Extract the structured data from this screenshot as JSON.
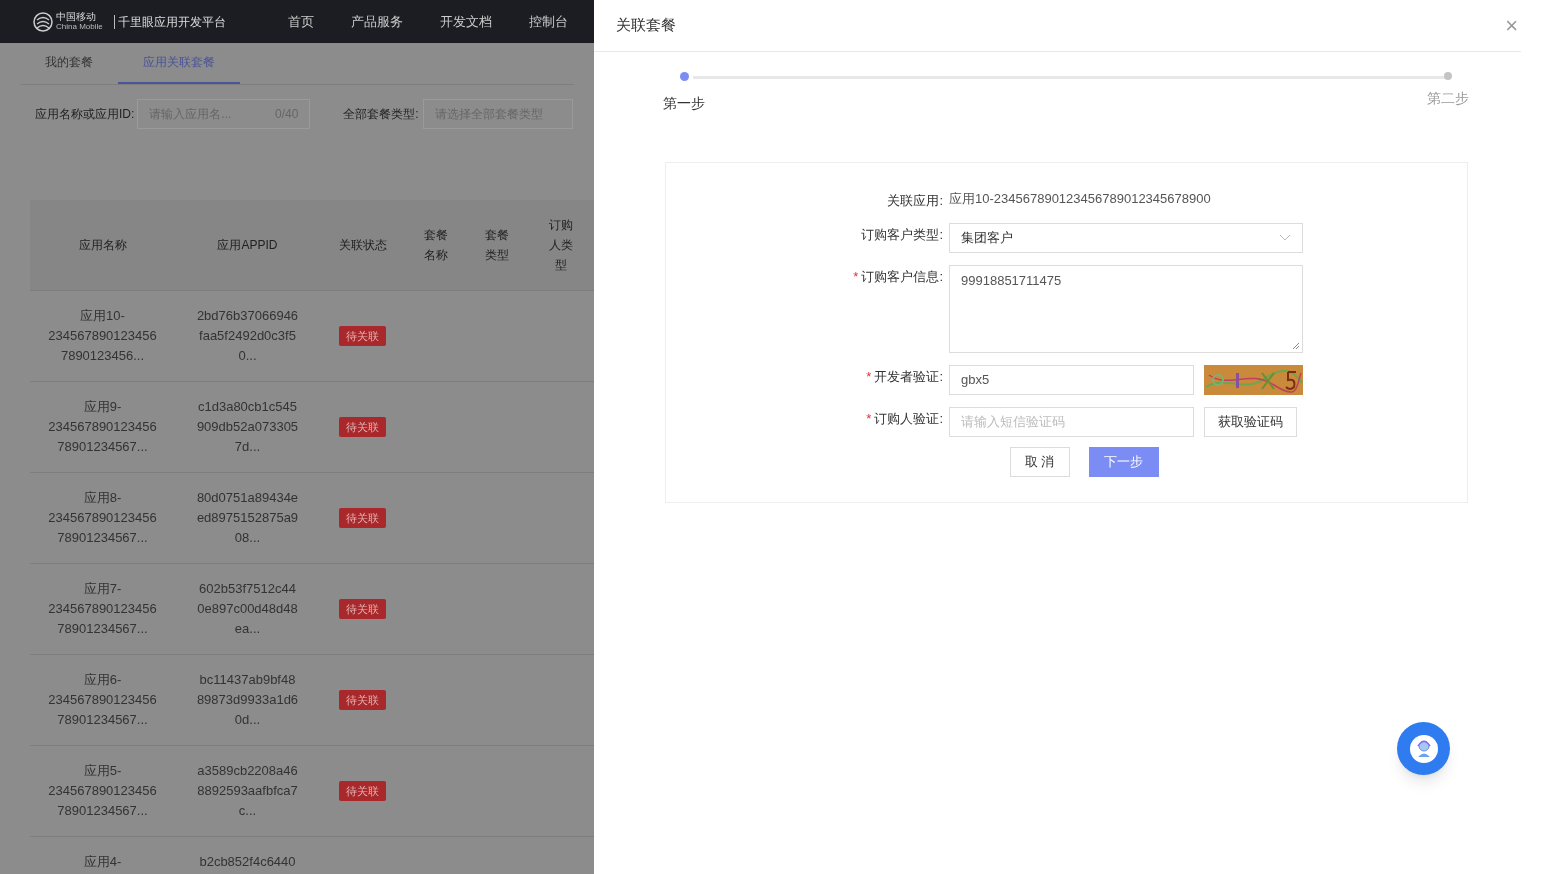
{
  "header": {
    "logo_cn": "中国移动",
    "logo_en": "China Mobile",
    "platform": "千里眼应用开发平台",
    "nav": [
      "首页",
      "产品服务",
      "开发文档",
      "控制台"
    ]
  },
  "tabs": [
    {
      "label": "我的套餐",
      "selected": false
    },
    {
      "label": "应用关联套餐",
      "selected": true
    }
  ],
  "filters": {
    "name_label": "应用名称或应用ID:",
    "name_placeholder": "请输入应用名...",
    "name_counter": "0/40",
    "type_label": "全部套餐类型:",
    "type_placeholder": "请选择全部套餐类型"
  },
  "table": {
    "columns": [
      [
        "应用名称"
      ],
      [
        "应用APPID"
      ],
      [
        "关联状态"
      ],
      [
        "套餐",
        "名称"
      ],
      [
        "套餐",
        "类型"
      ],
      [
        "订购",
        "人类",
        "型"
      ]
    ],
    "rows": [
      {
        "name": [
          "应用10-",
          "234567890123456",
          "7890123456..."
        ],
        "appid": [
          "2bd76b37066946",
          "faa5f2492d0c3f5",
          "0..."
        ],
        "status": "待关联"
      },
      {
        "name": [
          "应用9-",
          "234567890123456",
          "78901234567..."
        ],
        "appid": [
          "c1d3a80cb1c545",
          "909db52a073305",
          "7d..."
        ],
        "status": "待关联"
      },
      {
        "name": [
          "应用8-",
          "234567890123456",
          "78901234567..."
        ],
        "appid": [
          "80d0751a89434e",
          "ed8975152875a9",
          "08..."
        ],
        "status": "待关联"
      },
      {
        "name": [
          "应用7-",
          "234567890123456",
          "78901234567..."
        ],
        "appid": [
          "602b53f7512c44",
          "0e897c00d48d48",
          "ea..."
        ],
        "status": "待关联"
      },
      {
        "name": [
          "应用6-",
          "234567890123456",
          "78901234567..."
        ],
        "appid": [
          "bc11437ab9bf48",
          "89873d9933a1d6",
          "0d..."
        ],
        "status": "待关联"
      },
      {
        "name": [
          "应用5-",
          "234567890123456",
          "78901234567..."
        ],
        "appid": [
          "a3589cb2208a46",
          "8892593aafbfca7",
          "c..."
        ],
        "status": "待关联"
      },
      {
        "name": [
          "应用4-"
        ],
        "appid": [
          "b2cb852f4c6440"
        ]
      }
    ]
  },
  "drawer": {
    "title": "关联套餐",
    "close": "×",
    "steps": [
      {
        "label": "第一步",
        "selected": true
      },
      {
        "label": "第二步",
        "selected": false
      }
    ],
    "fields": [
      {
        "kind": "text",
        "label": "关联应用:",
        "required": false,
        "value": "应用10-234567890123456789012345678900"
      },
      {
        "kind": "select",
        "label": "订购客户类型:",
        "required": false,
        "value": "集团客户"
      },
      {
        "kind": "textarea",
        "label": "订购客户信息:",
        "required": true,
        "value": "99918851711475"
      },
      {
        "kind": "captcha",
        "label": "开发者验证:",
        "required": true,
        "value": "gbx5"
      },
      {
        "kind": "sms",
        "label": "订购人验证:",
        "required": true,
        "placeholder": "请输入短信验证码",
        "button": "获取验证码"
      }
    ],
    "required_mark": "*",
    "cancel": "取 消",
    "next": "下一步"
  }
}
